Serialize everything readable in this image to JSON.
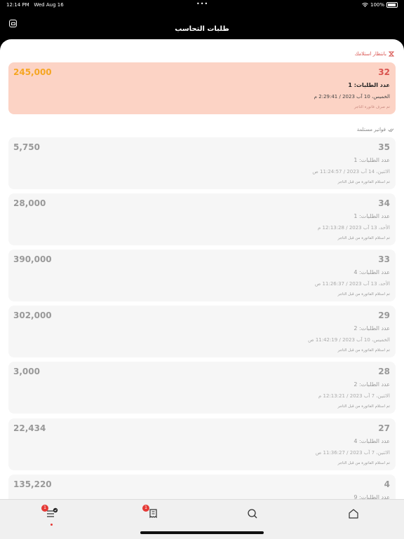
{
  "status_bar": {
    "time": "12:14 PM",
    "date": "Wed Aug 16",
    "battery": "100%"
  },
  "header": {
    "title": "طلبات التحاسب"
  },
  "pending_section": {
    "label": "بانتظار استلامك",
    "card": {
      "number": "32",
      "amount": "245,000",
      "count": "عدد الطلبات: 1",
      "date": "الخميس، 10 آب 2023 / 2:29:41 م",
      "status": "تم صرف فاتورة التاجر"
    }
  },
  "received_section": {
    "label": "فواتير مستلمة",
    "cards": [
      {
        "number": "35",
        "amount": "5,750",
        "count": "عدد الطلبات: 1",
        "date": "الاثنين، 14 آب 2023 / 11:24:57 ص",
        "status": "تم استلام الفاتورة من قبل التاجر"
      },
      {
        "number": "34",
        "amount": "28,000",
        "count": "عدد الطلبات: 1",
        "date": "الأحد، 13 آب 2023 / 12:13:28 م",
        "status": "تم استلام الفاتورة من قبل التاجر"
      },
      {
        "number": "33",
        "amount": "390,000",
        "count": "عدد الطلبات: 4",
        "date": "الأحد، 13 آب 2023 / 11:26:37 ص",
        "status": "تم استلام الفاتورة من قبل التاجر"
      },
      {
        "number": "29",
        "amount": "302,000",
        "count": "عدد الطلبات: 2",
        "date": "الخميس، 10 آب 2023 / 11:42:19 ص",
        "status": "تم استلام الفاتورة من قبل التاجر"
      },
      {
        "number": "28",
        "amount": "3,000",
        "count": "عدد الطلبات: 2",
        "date": "الاثنين، 7 آب 2023 / 12:13:21 م",
        "status": "تم استلام الفاتورة من قبل التاجر"
      },
      {
        "number": "27",
        "amount": "22,434",
        "count": "عدد الطلبات: 4",
        "date": "الاثنين، 7 آب 2023 / 11:36:27 ص",
        "status": "تم استلام الفاتورة من قبل التاجر"
      },
      {
        "number": "4",
        "amount": "135,220",
        "count": "عدد الطلبات: 9",
        "date": "",
        "status": ""
      }
    ]
  },
  "tabbar": {
    "orders_badge": "1",
    "invoices_badge": "1"
  },
  "colors": {
    "accent": "#e53935",
    "pending_bg": "#fcd3c5",
    "pending_amount": "#f5a623"
  }
}
